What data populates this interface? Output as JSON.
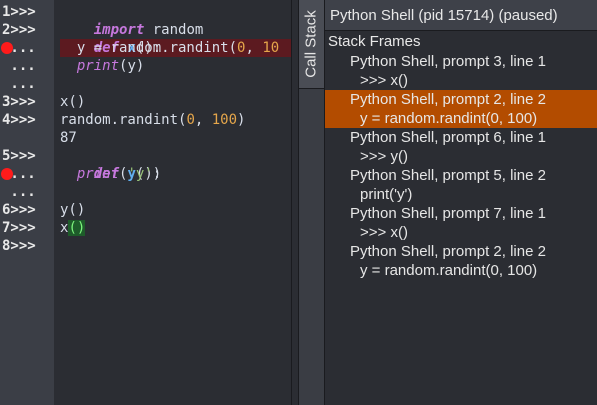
{
  "gutter": {
    "lines": [
      "1>>>",
      "2>>>",
      " ...",
      " ...",
      " ...",
      "3>>>",
      "4>>>",
      "",
      "5>>>",
      " ...",
      " ...",
      "6>>>",
      "7>>>",
      "8>>>"
    ]
  },
  "editor": {
    "l1": {
      "kw": "import",
      "rest": " random"
    },
    "l2": {
      "kw": "def",
      "name": "x",
      "rest": "():"
    },
    "l3": {
      "a": "y = random.randint(",
      "n1": "0",
      "b": ", ",
      "n2": "10"
    },
    "l4": {
      "kw": "print",
      "rest": "(y)"
    },
    "l6": "x()",
    "l7": {
      "a": "random.randint(",
      "n1": "0",
      "b": ", ",
      "n2": "100",
      "c": ")"
    },
    "l8": "87",
    "l9": {
      "kw": "def",
      "name": "y",
      "rest": "():"
    },
    "l10": {
      "kw": "print",
      "open": "(",
      "str": "'y'",
      "close": ")"
    },
    "l12": "y()",
    "l13": {
      "a": "x",
      "m": "()"
    }
  },
  "tab": {
    "label": "Call Stack"
  },
  "panel": {
    "title": "Python Shell (pid 15714) (paused)",
    "header": "Stack Frames",
    "frames": [
      {
        "loc": "Python Shell, prompt 3, line 1",
        "code": ">>> x()",
        "selected": false
      },
      {
        "loc": "Python Shell, prompt 2, line 2",
        "code": "y = random.randint(0, 100)",
        "selected": true
      },
      {
        "loc": "Python Shell, prompt 6, line 1",
        "code": ">>> y()",
        "selected": false
      },
      {
        "loc": "Python Shell, prompt 5, line 2",
        "code": "print('y')",
        "selected": false
      },
      {
        "loc": "Python Shell, prompt 7, line 1",
        "code": ">>> x()",
        "selected": false
      },
      {
        "loc": "Python Shell, prompt 2, line 2",
        "code": "y = random.randint(0, 100)",
        "selected": false
      }
    ]
  },
  "colors": {
    "breakpoint": "#ff1b1b",
    "selected_frame": "#b34c00",
    "current_line": "#5c1a20"
  }
}
